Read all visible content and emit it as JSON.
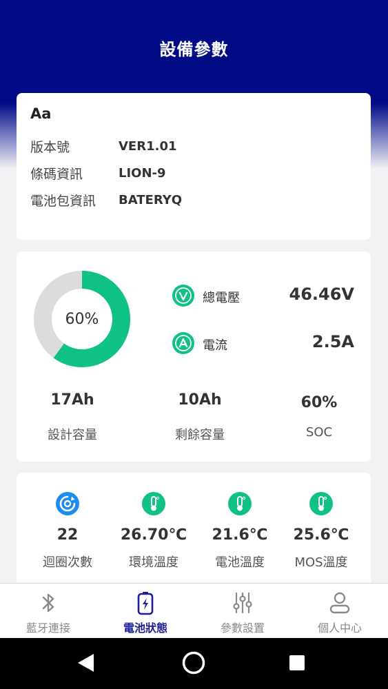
{
  "header": {
    "title": "設備參數"
  },
  "device": {
    "name": "Aa",
    "rows": [
      {
        "label": "版本號",
        "value": "VER1.01"
      },
      {
        "label": "條碼資訊",
        "value": "LION-9"
      },
      {
        "label": "電池包資訊",
        "value": "BATERYQ"
      }
    ]
  },
  "battery": {
    "soc_ring": {
      "percent": 60,
      "label": "60%"
    },
    "voltage": {
      "label": "總電壓",
      "value": "46.46V",
      "icon": "voltage-icon"
    },
    "current": {
      "label": "電流",
      "value": "2.5A",
      "icon": "ampere-icon"
    },
    "stats": [
      {
        "value": "17Ah",
        "label": "設計容量"
      },
      {
        "value": "10Ah",
        "label": "剩餘容量"
      },
      {
        "value": "60%",
        "label": "SOC"
      }
    ]
  },
  "temps": [
    {
      "value": "22",
      "label": "迴圈次數",
      "icon": "cycle-icon"
    },
    {
      "value": "26.70℃",
      "label": "環境溫度",
      "icon": "thermometer-icon"
    },
    {
      "value": "21.6℃",
      "label": "電池溫度",
      "icon": "thermometer-icon"
    },
    {
      "value": "25.6℃",
      "label": "MOS溫度",
      "icon": "thermometer-icon"
    }
  ],
  "nav": {
    "items": [
      {
        "label": "藍牙連接",
        "icon": "bluetooth-icon",
        "active": false
      },
      {
        "label": "電池狀態",
        "icon": "battery-icon",
        "active": true
      },
      {
        "label": "參數設置",
        "icon": "sliders-icon",
        "active": false
      },
      {
        "label": "個人中心",
        "icon": "user-icon",
        "active": false
      }
    ]
  },
  "colors": {
    "header": "#020b86",
    "accent_green": "#10c184",
    "ring_track": "#dcdcdc",
    "nav_active": "#1a1f96",
    "nav_inactive": "#888888",
    "cycle_blue": "#1d8cf0"
  }
}
